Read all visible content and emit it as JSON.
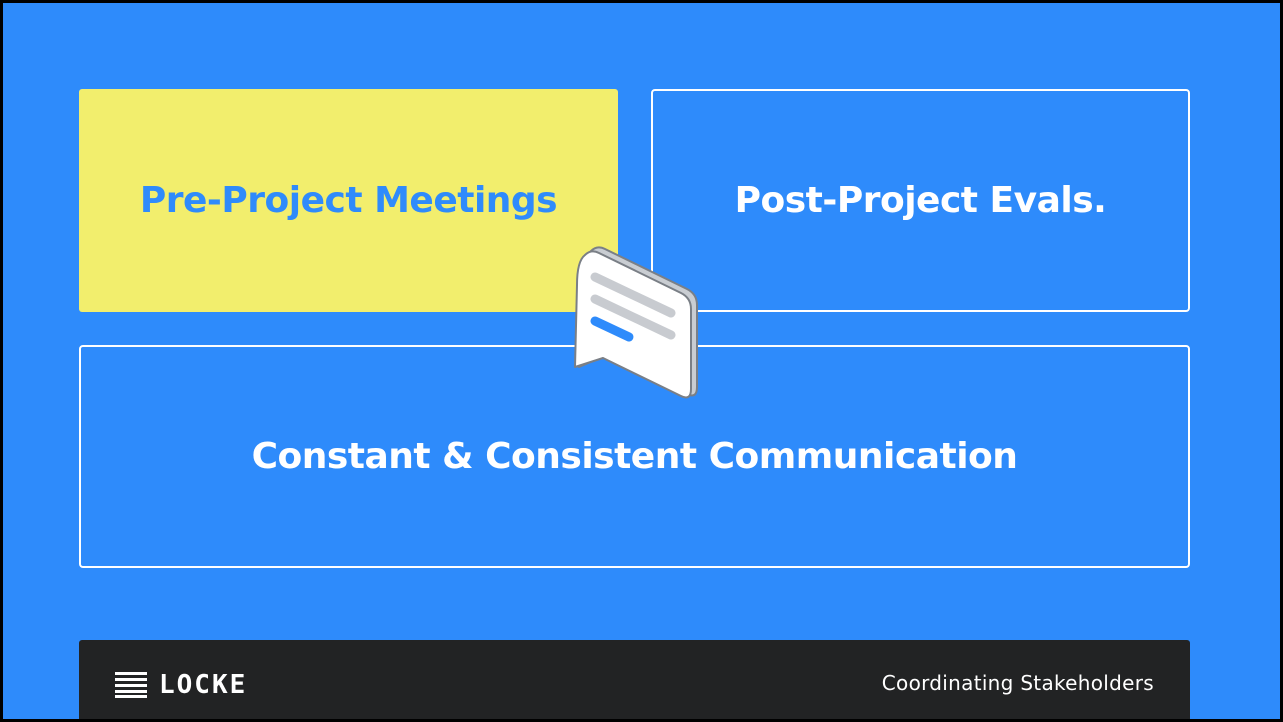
{
  "boxes": {
    "pre_project": "Pre-Project Meetings",
    "post_project": "Post-Project Evals.",
    "communication": "Constant & Consistent Communication"
  },
  "footer": {
    "brand": "LOCKE",
    "caption": "Coordinating Stakeholders"
  },
  "icons": {
    "chat": "chat-bubble-icon",
    "logo": "locke-logo-icon"
  },
  "colors": {
    "background": "#2e8bfb",
    "highlight": "#f2ee6d",
    "footer": "#222324",
    "text_light": "#ffffff"
  }
}
